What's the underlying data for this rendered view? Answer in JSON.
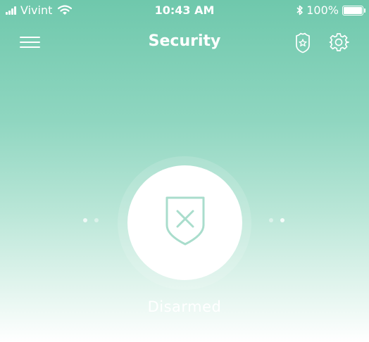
{
  "status_bar": {
    "carrier": "Vivint",
    "time": "10:43 AM",
    "battery": "100%",
    "battery_level": 1.0
  },
  "nav": {
    "title": "Security",
    "left_icon": "hamburger-menu-icon",
    "right_icons": [
      "police-badge-icon",
      "gear-icon"
    ]
  },
  "arm_control": {
    "icon": "shield-x-icon",
    "status": "Disarmed"
  },
  "pager": {
    "left_dots": 2,
    "right_dots": 2
  },
  "colors": {
    "accent": "#6fc8ac",
    "shield_stroke": "#a9ddcc",
    "text": "#ffffff"
  }
}
